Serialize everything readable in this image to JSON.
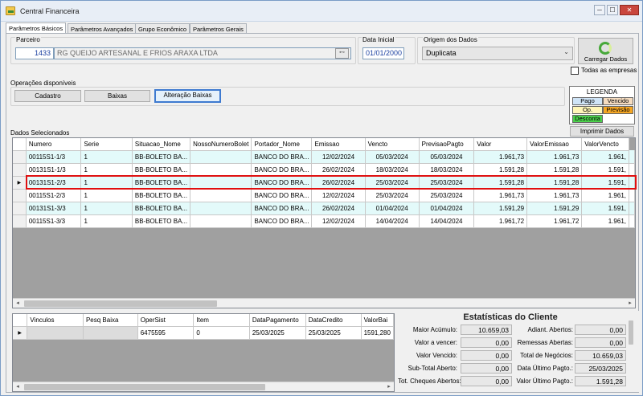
{
  "window": {
    "title": "Central Financeira",
    "min_label": "─",
    "max_label": "☐",
    "close_label": "✕"
  },
  "tabs": [
    "Parâmetros Básicos",
    "Parâmetros Avançados",
    "Grupo Econômico",
    "Parâmetros Gerais"
  ],
  "parceiro": {
    "label": "Parceiro",
    "code": "1433",
    "name": "RG QUEIJO ARTESANAL E FRIOS ARAXA LTDA"
  },
  "data_inicial": {
    "label": "Data Inicial",
    "value": "01/01/2000"
  },
  "origem": {
    "label": "Origem dos Dados",
    "value": "Duplicata"
  },
  "carregar_label": "Carregar Dados",
  "todas_empresas_label": "Todas as empresas",
  "operacoes": {
    "label": "Operações disponíveis",
    "buttons": [
      "Cadastro",
      "Baixas",
      "Alteração Baixas"
    ]
  },
  "legenda": {
    "title": "LEGENDA",
    "pago": "Pago",
    "vencido": "Vencido",
    "op": "Op.",
    "previsao": "Previsão",
    "desconta": "Desconta"
  },
  "colors": {
    "pago": "#cfe4f7",
    "vencido": "#f5dcc0",
    "op": "#fff6b8",
    "previsao": "#f5a623",
    "desconta": "#4cd14c",
    "selection_outline": "#e01010",
    "row_alt": "#e3fafa"
  },
  "imprimir_label": "Imprimir Dados",
  "dados_selecionados_label": "Dados Selecionados",
  "main_grid": {
    "columns": [
      "Numero",
      "Serie",
      "Situacao_Nome",
      "NossoNumeroBolet",
      "Portador_Nome",
      "Emissao",
      "Vencto",
      "PrevisaoPagto",
      "Valor",
      "ValorEmissao",
      "ValorVencto"
    ],
    "rows": [
      [
        "00115S1-1/3",
        "1",
        "BB-BOLETO BA...",
        "",
        "BANCO DO BRA...",
        "12/02/2024",
        "05/03/2024",
        "05/03/2024",
        "1.961,73",
        "1.961,73",
        "1.961,"
      ],
      [
        "00131S1-1/3",
        "1",
        "BB-BOLETO BA...",
        "",
        "BANCO DO BRA...",
        "26/02/2024",
        "18/03/2024",
        "18/03/2024",
        "1.591,28",
        "1.591,28",
        "1.591,"
      ],
      [
        "00131S1-2/3",
        "1",
        "BB-BOLETO BA...",
        "",
        "BANCO DO BRA...",
        "26/02/2024",
        "25/03/2024",
        "25/03/2024",
        "1.591,28",
        "1.591,28",
        "1.591,"
      ],
      [
        "00115S1-2/3",
        "1",
        "BB-BOLETO BA...",
        "",
        "BANCO DO BRA...",
        "12/02/2024",
        "25/03/2024",
        "25/03/2024",
        "1.961,73",
        "1.961,73",
        "1.961,"
      ],
      [
        "00131S1-3/3",
        "1",
        "BB-BOLETO BA...",
        "",
        "BANCO DO BRA...",
        "26/02/2024",
        "01/04/2024",
        "01/04/2024",
        "1.591,29",
        "1.591,29",
        "1.591,"
      ],
      [
        "00115S1-3/3",
        "1",
        "BB-BOLETO BA...",
        "",
        "BANCO DO BRA...",
        "12/02/2024",
        "14/04/2024",
        "14/04/2024",
        "1.961,72",
        "1.961,72",
        "1.961,"
      ]
    ],
    "current_row_index": 2
  },
  "bottom_grid": {
    "columns": [
      "Vinculos",
      "Pesq Baixa",
      "OperSist",
      "Item",
      "DataPagamento",
      "DataCredito",
      "ValorBai"
    ],
    "rows": [
      [
        "",
        "",
        "6475595",
        "0",
        "25/03/2025",
        "25/03/2025",
        "1591,280"
      ]
    ]
  },
  "estatisticas": {
    "title": "Estatísticas do Cliente",
    "left": [
      {
        "label": "Maior Acúmulo:",
        "value": "10.659,03"
      },
      {
        "label": "Valor a vencer:",
        "value": "0,00"
      },
      {
        "label": "Valor Vencido:",
        "value": "0,00"
      },
      {
        "label": "Sub-Total Aberto:",
        "value": "0,00"
      },
      {
        "label": "Tot. Cheques Abertos:",
        "value": "0,00"
      }
    ],
    "right": [
      {
        "label": "Adiant. Abertos:",
        "value": "0,00"
      },
      {
        "label": "Remessas Abertas:",
        "value": "0,00"
      },
      {
        "label": "Total de Negócios:",
        "value": "10.659,03"
      },
      {
        "label": "Data Último Pagto.:",
        "value": "25/03/2025"
      },
      {
        "label": "Valor Último Pagto.:",
        "value": "1.591,28"
      }
    ]
  },
  "icons": {
    "row_indicator": "▶",
    "lookup": "binoculars-icon",
    "dropdown": "chevron-down-icon",
    "refresh": "refresh-icon"
  }
}
